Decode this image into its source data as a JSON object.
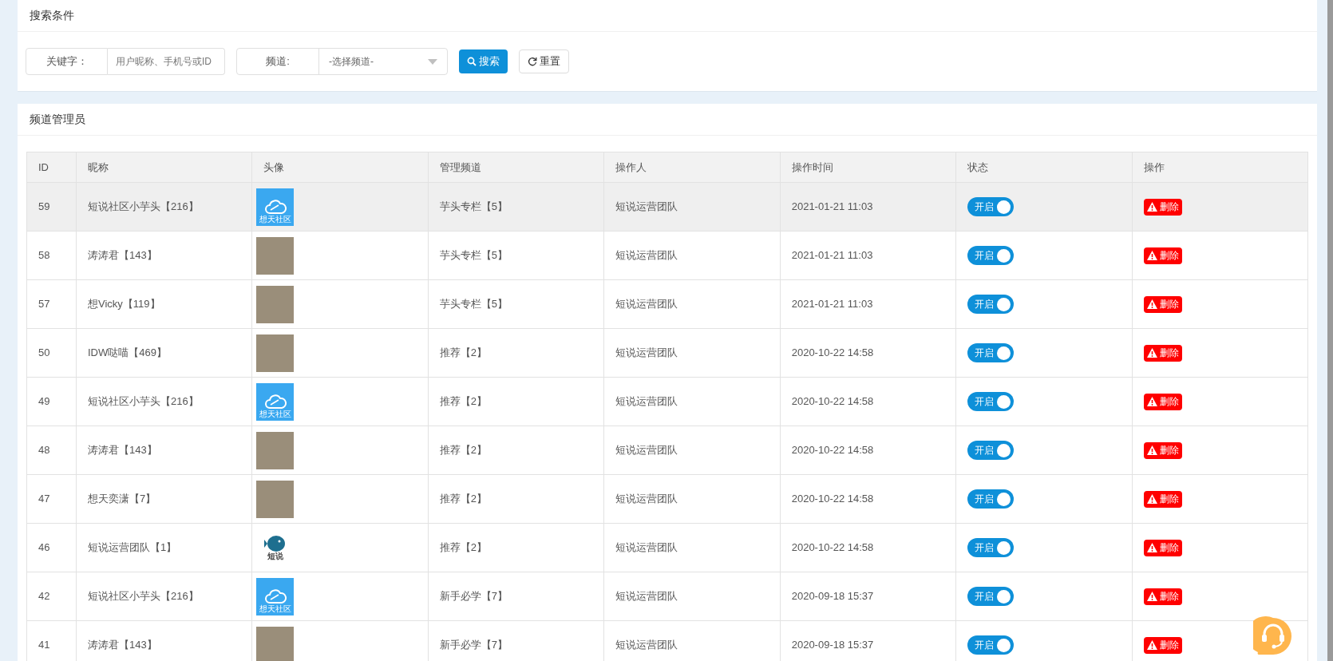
{
  "search_panel": {
    "title": "搜索条件",
    "keyword": {
      "label": "关键字：",
      "placeholder": "用户昵称、手机号或ID"
    },
    "channel": {
      "label": "频道:",
      "value": "-选择频道-"
    },
    "search_button": "搜索",
    "reset_button": "重置"
  },
  "table_panel": {
    "title": "频道管理员",
    "table": {
      "columns": [
        "ID",
        "昵称",
        "头像",
        "管理频道",
        "操作人",
        "操作时间",
        "状态",
        "操作"
      ],
      "rows": [
        {
          "id": "59",
          "nickname": "短说社区小芋头【216】",
          "avatar": {
            "kind": "cloud-logo",
            "label": "想天社区"
          },
          "channel": "芋头专栏【5】",
          "operator": "短说运营团队",
          "time": "2021-01-21 11:03",
          "status": {
            "label": "开启",
            "on": true
          },
          "action": "删除",
          "selected": true
        },
        {
          "id": "58",
          "nickname": "涛涛君【143】",
          "avatar": {
            "kind": "photo"
          },
          "channel": "芋头专栏【5】",
          "operator": "短说运营团队",
          "time": "2021-01-21 11:03",
          "status": {
            "label": "开启",
            "on": true
          },
          "action": "删除",
          "selected": false
        },
        {
          "id": "57",
          "nickname": "想Vicky【119】",
          "avatar": {
            "kind": "photo"
          },
          "channel": "芋头专栏【5】",
          "operator": "短说运营团队",
          "time": "2021-01-21 11:03",
          "status": {
            "label": "开启",
            "on": true
          },
          "action": "删除",
          "selected": false
        },
        {
          "id": "50",
          "nickname": "IDW哒喵【469】",
          "avatar": {
            "kind": "photo"
          },
          "channel": "推荐【2】",
          "operator": "短说运营团队",
          "time": "2020-10-22 14:58",
          "status": {
            "label": "开启",
            "on": true
          },
          "action": "删除",
          "selected": false
        },
        {
          "id": "49",
          "nickname": "短说社区小芋头【216】",
          "avatar": {
            "kind": "cloud-logo",
            "label": "想天社区"
          },
          "channel": "推荐【2】",
          "operator": "短说运营团队",
          "time": "2020-10-22 14:58",
          "status": {
            "label": "开启",
            "on": true
          },
          "action": "删除",
          "selected": false
        },
        {
          "id": "48",
          "nickname": "涛涛君【143】",
          "avatar": {
            "kind": "photo"
          },
          "channel": "推荐【2】",
          "operator": "短说运营团队",
          "time": "2020-10-22 14:58",
          "status": {
            "label": "开启",
            "on": true
          },
          "action": "删除",
          "selected": false
        },
        {
          "id": "47",
          "nickname": "想天奕潇【7】",
          "avatar": {
            "kind": "photo"
          },
          "channel": "推荐【2】",
          "operator": "短说运营团队",
          "time": "2020-10-22 14:58",
          "status": {
            "label": "开启",
            "on": true
          },
          "action": "删除",
          "selected": false
        },
        {
          "id": "46",
          "nickname": "短说运营团队【1】",
          "avatar": {
            "kind": "fish-logo",
            "label": "短说"
          },
          "channel": "推荐【2】",
          "operator": "短说运营团队",
          "time": "2020-10-22 14:58",
          "status": {
            "label": "开启",
            "on": true
          },
          "action": "删除",
          "selected": false
        },
        {
          "id": "42",
          "nickname": "短说社区小芋头【216】",
          "avatar": {
            "kind": "cloud-logo",
            "label": "想天社区"
          },
          "channel": "新手必学【7】",
          "operator": "短说运营团队",
          "time": "2020-09-18 15:37",
          "status": {
            "label": "开启",
            "on": true
          },
          "action": "删除",
          "selected": false
        },
        {
          "id": "41",
          "nickname": "涛涛君【143】",
          "avatar": {
            "kind": "photo"
          },
          "channel": "新手必学【7】",
          "operator": "短说运营团队",
          "time": "2020-09-18 15:37",
          "status": {
            "label": "开启",
            "on": true
          },
          "action": "删除",
          "selected": false
        }
      ]
    }
  }
}
